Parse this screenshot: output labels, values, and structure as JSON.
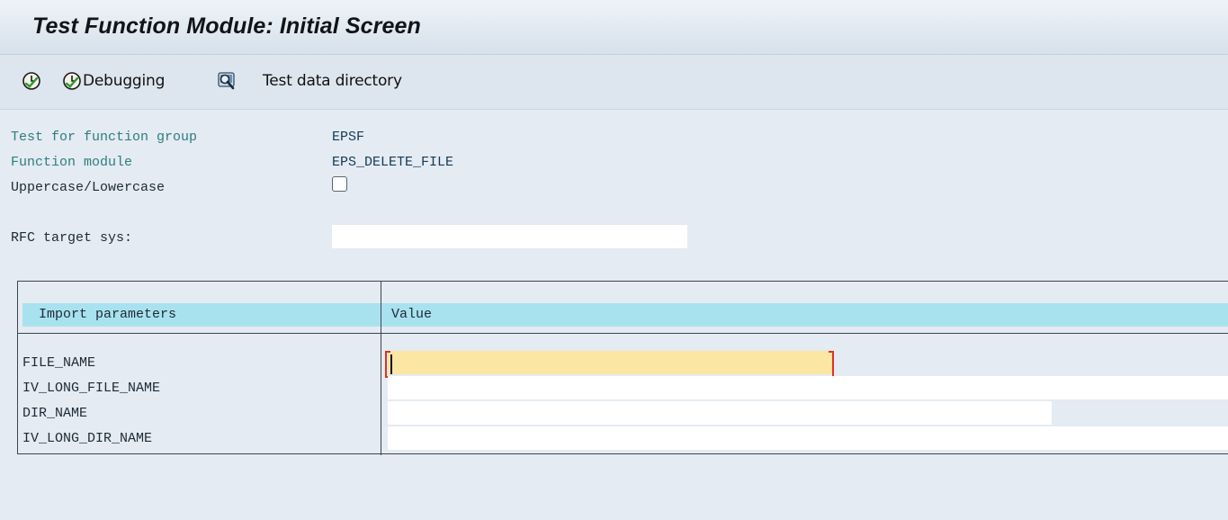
{
  "window": {
    "title": "Test Function Module: Initial Screen"
  },
  "toolbar": {
    "execute_icon": "execute-clock-icon",
    "debug_icon": "debug-clock-icon",
    "debug_label": "Debugging",
    "testdata_icon": "test-data-directory-icon",
    "testdata_label": "Test data directory"
  },
  "header": {
    "group_label": "Test for function group",
    "group_value": "EPSF",
    "module_label": "Function module",
    "module_value": "EPS_DELETE_FILE",
    "case_label": "Uppercase/Lowercase",
    "case_checked": false,
    "rfc_label": "RFC target sys:",
    "rfc_value": ""
  },
  "params": {
    "col_param": "Import parameters",
    "col_value": "Value",
    "rows": [
      {
        "name": "FILE_NAME",
        "value": ""
      },
      {
        "name": "IV_LONG_FILE_NAME",
        "value": ""
      },
      {
        "name": "DIR_NAME",
        "value": ""
      },
      {
        "name": "IV_LONG_DIR_NAME",
        "value": ""
      }
    ]
  },
  "colors": {
    "background": "#e4ebf2",
    "label_teal": "#2e7d80",
    "header_cyan": "#a9e2ef",
    "focus_yellow": "#fbe6a4",
    "focus_bracket": "#e03020"
  }
}
